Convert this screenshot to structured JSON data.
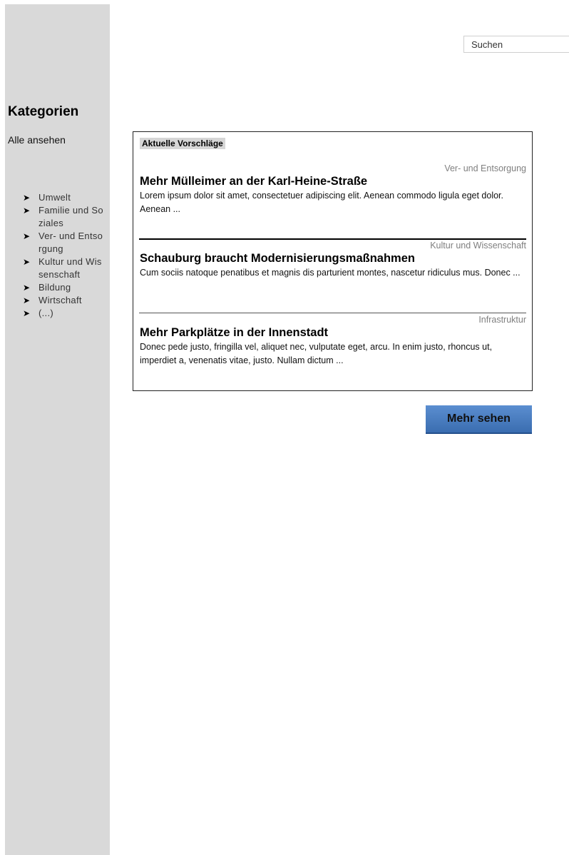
{
  "search": {
    "placeholder": "Suchen"
  },
  "sidebar": {
    "title": "Kategorien",
    "see_all": "Alle ansehen",
    "bullet": "➤",
    "items": [
      {
        "label": "Umwelt"
      },
      {
        "label": "Familie und Soziales"
      },
      {
        "label": "Ver- und Entsorgung"
      },
      {
        "label": "Kultur und Wissenschaft"
      },
      {
        "label": "Bildung"
      },
      {
        "label": "Wirtschaft"
      },
      {
        "label": "(...)"
      }
    ]
  },
  "panel": {
    "heading": "Aktuelle Vorschläge",
    "articles": [
      {
        "category": "Ver- und Entsorgung",
        "title": "Mehr Mülleimer an der Karl-Heine-Straße",
        "body": "Lorem ipsum dolor sit amet, consectetuer adipiscing elit. Aenean commodo ligula eget dolor. Aenean ..."
      },
      {
        "category": "Kultur und Wissenschaft",
        "title": "Schauburg braucht Modernisierungsmaßnahmen",
        "body": "Cum sociis natoque penatibus et magnis dis parturient montes, nascetur ridiculus mus. Donec ..."
      },
      {
        "category": "Infrastruktur",
        "title": "Mehr Parkplätze in der Innenstadt",
        "body": "Donec pede justo, fringilla vel, aliquet nec, vulputate eget, arcu. In enim justo, rhoncus ut, imperdiet a, venenatis vitae, justo. Nullam dictum ..."
      }
    ]
  },
  "more_button": {
    "label": "Mehr sehen"
  },
  "colors": {
    "sidebar_bg": "#d9d9d9",
    "button_blue": "#4a7cc0",
    "category_gray": "#7f7f7f"
  }
}
